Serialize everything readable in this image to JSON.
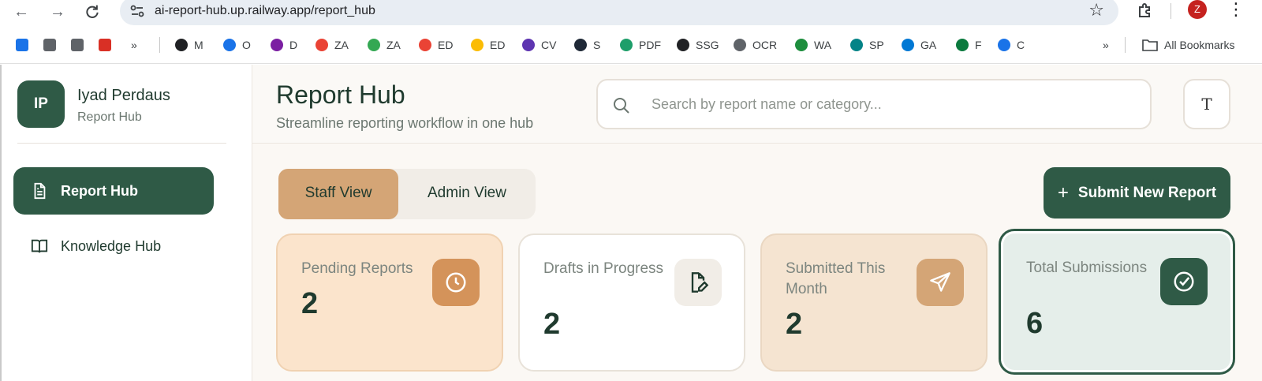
{
  "browser": {
    "url": "ai-report-hub.up.railway.app/report_hub",
    "profile_initial": "Z",
    "bookmarks": [
      {
        "label": "",
        "color": "#1a73e8"
      },
      {
        "label": "",
        "color": "#5f6368"
      },
      {
        "label": "",
        "color": "#5f6368"
      },
      {
        "label": "",
        "color": "#d93025"
      },
      {
        "label": "»",
        "color": ""
      },
      {
        "label": "M",
        "color": "#202124"
      },
      {
        "label": "O",
        "color": "#1a73e8"
      },
      {
        "label": "D",
        "color": "#7b1fa2"
      },
      {
        "label": "ZA",
        "color": "#ea4335"
      },
      {
        "label": "ZA",
        "color": "#34a853"
      },
      {
        "label": "ED",
        "color": "#ea4335"
      },
      {
        "label": "ED",
        "color": "#fbbc04"
      },
      {
        "label": "CV",
        "color": "#5e35b1"
      },
      {
        "label": "S",
        "color": "#1f2937"
      },
      {
        "label": "PDF",
        "color": "#1e9e6a"
      },
      {
        "label": "SSG",
        "color": "#202124"
      },
      {
        "label": "OCR",
        "color": "#5f6368"
      },
      {
        "label": "WA",
        "color": "#1e8e3e"
      },
      {
        "label": "SP",
        "color": "#038387"
      },
      {
        "label": "GA",
        "color": "#0078d4"
      },
      {
        "label": "F",
        "color": "#0b7a3e"
      },
      {
        "label": "C",
        "color": "#1a73e8"
      }
    ],
    "overflow": "»",
    "all_bookmarks": "All Bookmarks"
  },
  "sidebar": {
    "avatar_initials": "IP",
    "user_name": "Iyad Perdaus",
    "app_name": "Report Hub",
    "items": [
      {
        "label": "Report Hub",
        "icon": "document-icon",
        "active": true
      },
      {
        "label": "Knowledge Hub",
        "icon": "book-icon",
        "active": false
      }
    ]
  },
  "header": {
    "title": "Report Hub",
    "subtitle": "Streamline reporting workflow in one hub",
    "search_placeholder": "Search by report name or category...",
    "theme_button": "T"
  },
  "view_toggle": {
    "staff": "Staff View",
    "admin": "Admin View",
    "selected": "Staff View"
  },
  "actions": {
    "submit_new_report": "Submit New Report"
  },
  "stats": [
    {
      "label": "Pending Reports",
      "value": "2",
      "icon": "clock-icon",
      "icon_bg": "#d4935a"
    },
    {
      "label": "Drafts in Progress",
      "value": "2",
      "icon": "file-edit-icon",
      "icon_bg": "#f1ede7"
    },
    {
      "label": "Submitted This Month",
      "value": "2",
      "icon": "send-icon",
      "icon_bg": "#d4a576"
    },
    {
      "label": "Total Submissions",
      "value": "6",
      "icon": "check-circle-icon",
      "icon_bg": "#2f5a46"
    }
  ]
}
